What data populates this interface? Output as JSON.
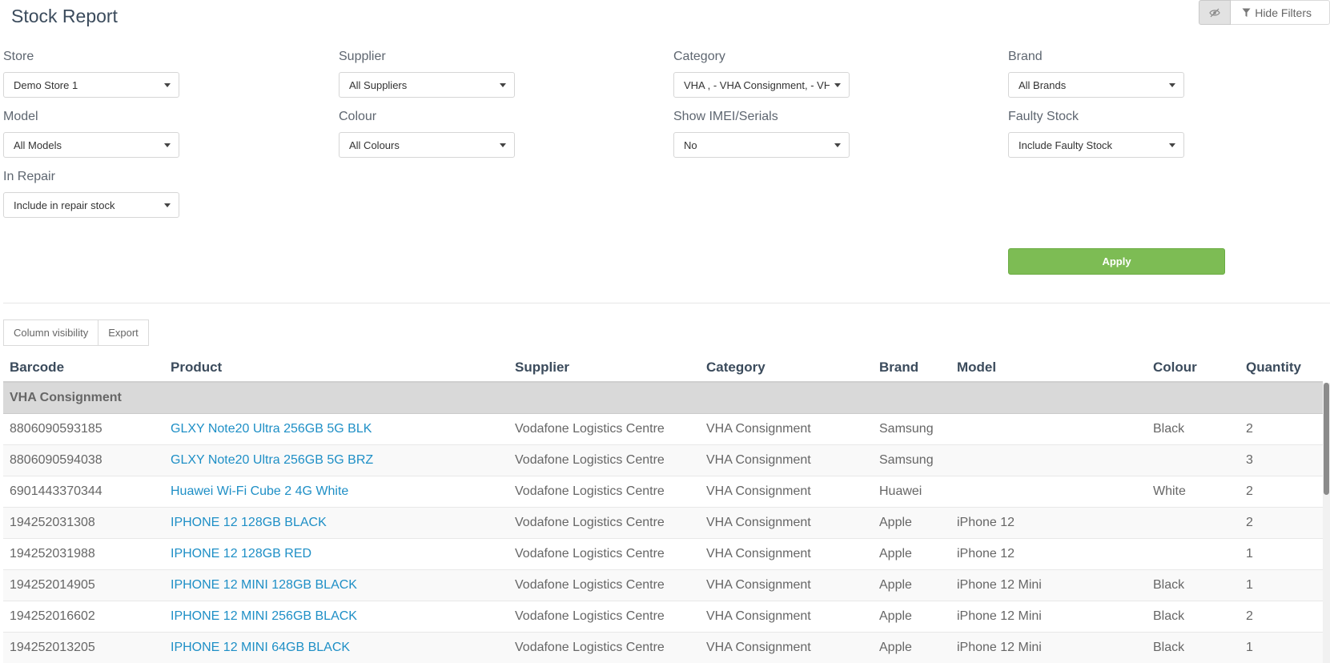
{
  "page": {
    "title": "Stock Report"
  },
  "top_actions": {
    "hide_filters_label": "Hide Filters"
  },
  "filters": [
    {
      "label": "Store",
      "value": "Demo Store 1"
    },
    {
      "label": "Supplier",
      "value": "All Suppliers"
    },
    {
      "label": "Category",
      "value": "VHA , - VHA Consignment, - VHA"
    },
    {
      "label": "Brand",
      "value": "All Brands"
    },
    {
      "label": "Model",
      "value": "All Models"
    },
    {
      "label": "Colour",
      "value": "All Colours"
    },
    {
      "label": "Show IMEI/Serials",
      "value": "No"
    },
    {
      "label": "Faulty Stock",
      "value": "Include Faulty Stock"
    },
    {
      "label": "In Repair",
      "value": "Include in repair stock"
    }
  ],
  "apply_label": "Apply",
  "table_tools": {
    "column_visibility": "Column visibility",
    "export": "Export"
  },
  "table": {
    "columns": [
      "Barcode",
      "Product",
      "Supplier",
      "Category",
      "Brand",
      "Model",
      "Colour",
      "Quantity"
    ],
    "group": "VHA Consignment",
    "rows": [
      [
        "8806090593185",
        "GLXY Note20 Ultra 256GB 5G BLK",
        "Vodafone Logistics Centre",
        "VHA Consignment",
        "Samsung",
        "",
        "Black",
        "2"
      ],
      [
        "8806090594038",
        "GLXY Note20 Ultra 256GB 5G BRZ",
        "Vodafone Logistics Centre",
        "VHA Consignment",
        "Samsung",
        "",
        "",
        "3"
      ],
      [
        "6901443370344",
        "Huawei Wi-Fi Cube 2 4G White",
        "Vodafone Logistics Centre",
        "VHA Consignment",
        "Huawei",
        "",
        "White",
        "2"
      ],
      [
        "194252031308",
        "IPHONE 12 128GB BLACK",
        "Vodafone Logistics Centre",
        "VHA Consignment",
        "Apple",
        "iPhone 12",
        "",
        "2"
      ],
      [
        "194252031988",
        "IPHONE 12 128GB RED",
        "Vodafone Logistics Centre",
        "VHA Consignment",
        "Apple",
        "iPhone 12",
        "",
        "1"
      ],
      [
        "194252014905",
        "IPHONE 12 MINI 128GB BLACK",
        "Vodafone Logistics Centre",
        "VHA Consignment",
        "Apple",
        "iPhone 12 Mini",
        "Black",
        "1"
      ],
      [
        "194252016602",
        "IPHONE 12 MINI 256GB BLACK",
        "Vodafone Logistics Centre",
        "VHA Consignment",
        "Apple",
        "iPhone 12 Mini",
        "Black",
        "2"
      ],
      [
        "194252013205",
        "IPHONE 12 MINI 64GB BLACK",
        "Vodafone Logistics Centre",
        "VHA Consignment",
        "Apple",
        "iPhone 12 Mini",
        "Black",
        "1"
      ]
    ]
  },
  "colors": {
    "accent_green": "#7dbc54",
    "link_blue": "#1e8fc6",
    "group_bg": "#d9d9d9"
  },
  "icons": {
    "eye": "eye-slash-icon",
    "filter": "filter-icon",
    "caret": "caret-down-icon"
  }
}
